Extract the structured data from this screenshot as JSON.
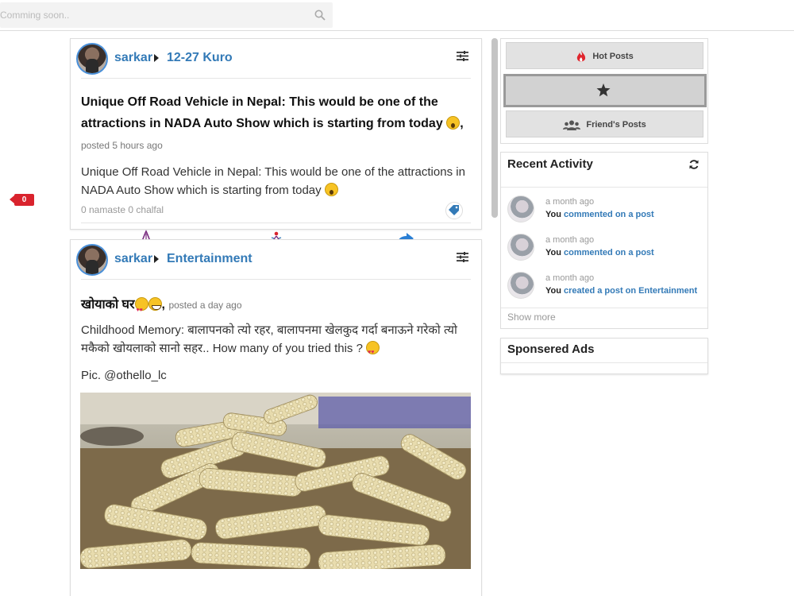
{
  "search": {
    "placeholder": "Comming soon.."
  },
  "notifications": {
    "count": "0"
  },
  "posts": [
    {
      "author": "sarkar",
      "group": "12-27 Kuro",
      "title": "Unique Off Road Vehicle in Nepal: This would be one of the attractions in NADA Auto Show which is starting from today",
      "title_suffix": ",",
      "posted": "posted 5 hours ago",
      "body": "Unique Off Road Vehicle in Nepal: This would be one of the attractions in NADA Auto Show which is starting from today",
      "namaste": "0 namaste",
      "chalfal": "0 chalfal"
    },
    {
      "author": "sarkar",
      "group": "Entertainment",
      "title": "खोयाको घर",
      "title_suffix": ",",
      "posted": "posted a day ago",
      "body": "Childhood Memory: बालापनको त्यो रहर, बालापनमा खेलकुद गर्दा बनाऊने गरेको त्यो मकैको खोयलाको सानो सहर.. How many of you tried this ?",
      "credit": "Pic. @othello_lc"
    }
  ],
  "filters": {
    "hot": "Hot Posts",
    "friends": "Friend's Posts"
  },
  "activity": {
    "title": "Recent Activity",
    "items": [
      {
        "time": "a month ago",
        "you": "You",
        "action": "commented on a post"
      },
      {
        "time": "a month ago",
        "you": "You",
        "action": "commented on a post"
      },
      {
        "time": "a month ago",
        "you": "You",
        "action": "created a post on Entertainment"
      }
    ],
    "show_more": "Show more"
  },
  "ads": {
    "title": "Sponsered Ads"
  },
  "colors": {
    "link": "#337ab7",
    "badge": "#d9232d",
    "hot": "#e0262e"
  }
}
